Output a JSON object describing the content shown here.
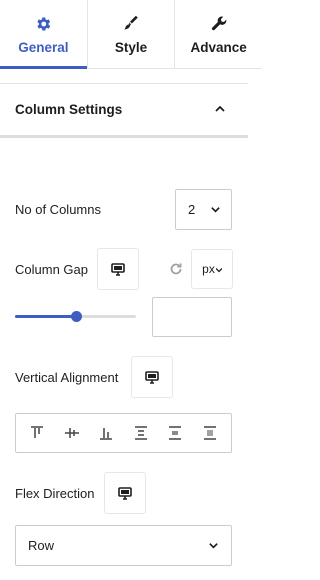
{
  "tabs": [
    {
      "label": "General",
      "icon": "gear-icon",
      "active": true
    },
    {
      "label": "Style",
      "icon": "paintbrush-icon",
      "active": false
    },
    {
      "label": "Advance",
      "icon": "wrench-icon",
      "active": false
    }
  ],
  "panel": {
    "title": "Column Settings",
    "toggle_icon": "chevron-up-icon"
  },
  "columns": {
    "label": "No of Columns",
    "value": "2"
  },
  "column_gap": {
    "label": "Column Gap",
    "unit": "px",
    "value": "",
    "slider_fraction": 0.5
  },
  "vertical_alignment": {
    "label": "Vertical Alignment",
    "options": [
      "align-top-icon",
      "align-center-icon",
      "align-bottom-icon",
      "justify-space-between-icon",
      "justify-space-around-icon",
      "justify-space-evenly-icon"
    ]
  },
  "flex_direction": {
    "label": "Flex Direction",
    "value": "Row"
  },
  "colors": {
    "accent": "#3f5ec1",
    "text": "#1e1e1e",
    "border": "#c9ccd1"
  }
}
